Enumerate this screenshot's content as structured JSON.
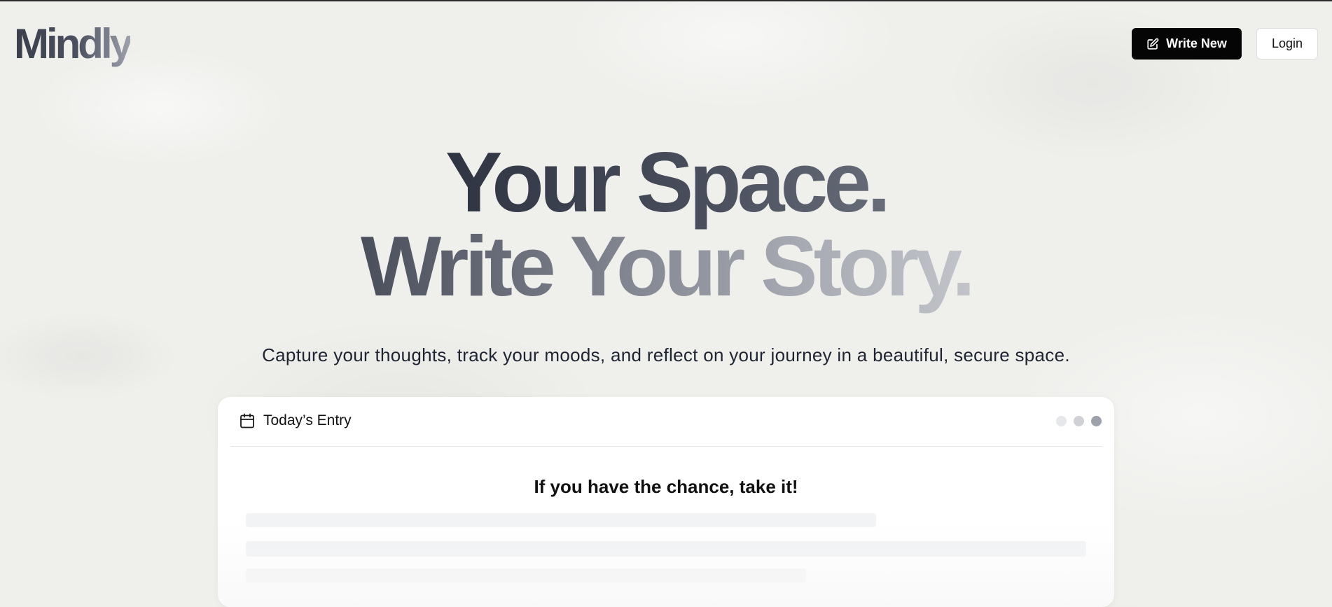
{
  "brand": {
    "logo": "Mindly"
  },
  "header": {
    "write_new_label": "Write New",
    "login_label": "Login",
    "write_icon": "pencil-square-icon"
  },
  "hero": {
    "line1": "Your Space.",
    "line2": "Write Your Story.",
    "subtitle": "Capture your thoughts, track your moods, and reflect on your journey in a beautiful, secure space."
  },
  "entry_card": {
    "icon": "calendar-icon",
    "title": "Today’s Entry",
    "heading": "If you have the chance, take it!",
    "window_dots": 3
  },
  "colors": {
    "background": "#efefec",
    "primary_button": "#050505",
    "text_dark": "#1f2433"
  }
}
